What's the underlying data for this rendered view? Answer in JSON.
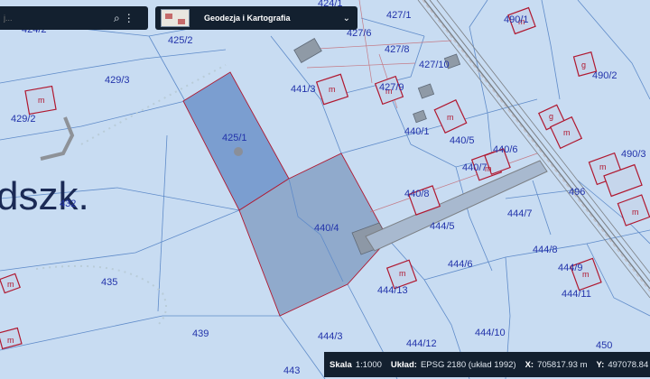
{
  "search": {
    "placeholder": "j...",
    "value": ""
  },
  "layer": {
    "name": "Geodezja i Kartografia"
  },
  "map": {
    "place_label": "dszk.",
    "parcel_labels": [
      "424/2",
      "425/2",
      "429/3",
      "429/2",
      "425/1",
      "441/3",
      "427/6",
      "427/8",
      "427/10",
      "427/9",
      "424/1",
      "427/1",
      "490/1",
      "490/2",
      "440/1",
      "440/5",
      "440/6",
      "440/7",
      "490/3",
      "496",
      "440/8",
      "440/4",
      "444/5",
      "444/7",
      "432",
      "444/6",
      "444/8",
      "444/9",
      "444/13",
      "444/11",
      "435",
      "439",
      "444/3",
      "444/10",
      "444/12",
      "450",
      "443"
    ],
    "building_marker": "m",
    "garage_marker": "g"
  },
  "status": {
    "scale_label": "Skala",
    "scale_value": "1:1000",
    "crs_label": "Układ:",
    "crs_value": "EPSG 2180 (układ 1992)",
    "x_label": "X:",
    "x_value": "705817.93 m",
    "y_label": "Y:",
    "y_value": "497078.84 m"
  },
  "colors": {
    "background": "#c8dcf2",
    "parcel_line": "#5f8bc9",
    "selected": "#6f8fbf",
    "building": "#b01830",
    "road": "#7b7f84"
  }
}
